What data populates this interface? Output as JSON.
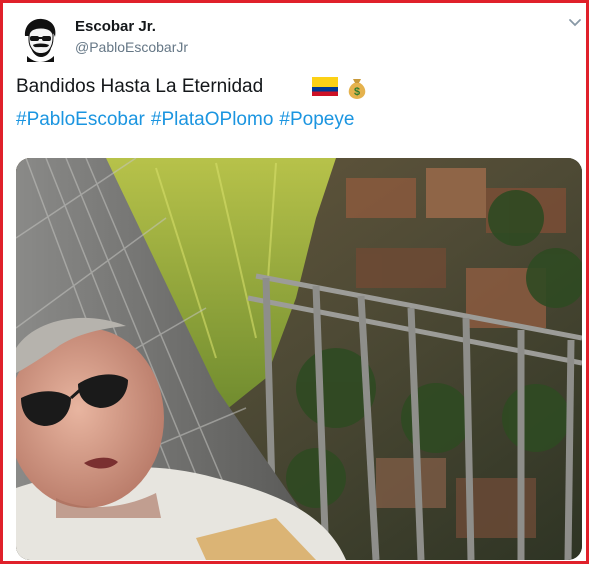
{
  "tweet": {
    "author_name": "Escobar Jr.",
    "author_handle": "@PabloEscobarJr",
    "text": "Bandidos Hasta La Eternidad",
    "emojis": [
      "colombia-flag-emoji",
      "money-bag-emoji"
    ],
    "hashtags": [
      "#PabloEscobar",
      "#PlataOPlomo",
      "#Popeye"
    ]
  },
  "colors": {
    "frame_border": "#e0202a",
    "hashtag": "#1b95e0",
    "name": "#14171a",
    "handle": "#657786"
  },
  "media": {
    "type": "video-still",
    "description_icon": "video-frame"
  }
}
